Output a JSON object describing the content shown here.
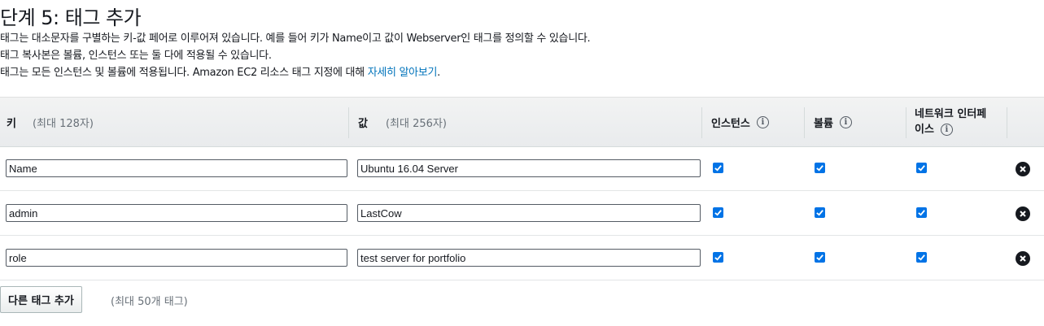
{
  "page": {
    "title": "단계 5: 태그 추가",
    "desc_line1": "태그는 대소문자를 구별하는 키-값 페어로 이루어져 있습니다. 예를 들어 키가 Name이고 값이 Webserver인 태그를 정의할 수 있습니다.",
    "desc_line2": "태그 복사본은 볼륨, 인스턴스 또는 둘 다에 적용될 수 있습니다.",
    "desc_line3_prefix": "태그는 모든 인스턴스 및 볼륨에 적용됩니다. Amazon EC2 리소스 태그 지정에 대해 ",
    "desc_line3_link": "자세히 알아보기",
    "desc_line3_suffix": "."
  },
  "table": {
    "col_key": "키",
    "col_key_hint": "(최대 128자)",
    "col_value": "값",
    "col_value_hint": "(최대 256자)",
    "col_instances": "인스턴스",
    "col_volumes": "볼륨",
    "col_network_line1": "네트워크 인터페",
    "col_network_line2": "이스",
    "info_glyph": "i",
    "rows": [
      {
        "key": "Name",
        "value": "Ubuntu 16.04 Server",
        "instances": true,
        "volumes": true,
        "network": true
      },
      {
        "key": "admin",
        "value": "LastCow",
        "instances": true,
        "volumes": true,
        "network": true
      },
      {
        "key": "role",
        "value": "test server for portfolio",
        "instances": true,
        "volumes": true,
        "network": true
      }
    ]
  },
  "footer": {
    "add_button": "다른 태그 추가",
    "limit_text": "(최대 50개 태그)"
  },
  "colors": {
    "checkbox": "#0073e6",
    "link": "#0073bb"
  },
  "icons": {
    "info": "info-icon",
    "remove": "close-circle-icon",
    "check": "checkmark-icon"
  }
}
